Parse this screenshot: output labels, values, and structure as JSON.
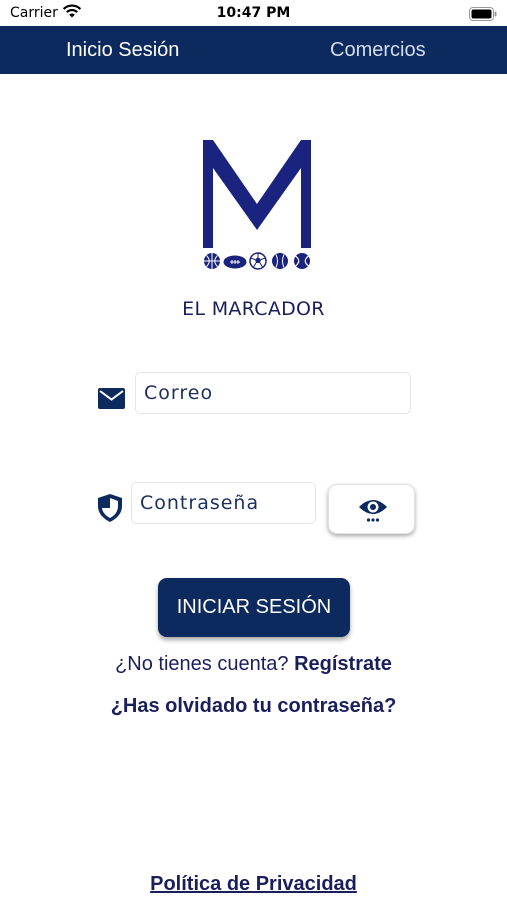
{
  "status_bar": {
    "carrier": "Carrier",
    "time": "10:47 PM",
    "icons": [
      "wifi-icon",
      "battery-icon"
    ]
  },
  "navbar": {
    "tabs": [
      {
        "label": "Inicio Sesión",
        "active": true
      },
      {
        "label": "Comercios",
        "active": false
      }
    ]
  },
  "logo": {
    "letter": "M",
    "app_name": "EL MARCADOR",
    "balls": [
      "basketball-icon",
      "football-icon",
      "soccer-ball-icon",
      "baseball-icon",
      "tennis-ball-icon"
    ]
  },
  "form": {
    "email_placeholder": "Correo",
    "email_value": "",
    "password_placeholder": "Contraseña",
    "password_value": "",
    "email_icon": "envelope-icon",
    "password_icon": "shield-icon",
    "toggle_icon": "eye-icon",
    "submit_label": "INICIAR SESIÓN"
  },
  "links": {
    "no_account": "¿No tienes cuenta?",
    "register": "Regístrate",
    "forgot_password": "¿Has olvidado tu contraseña?",
    "privacy": "Política de Privacidad"
  },
  "colors": {
    "primary": "#0c2a5e",
    "text": "#1a1f5c",
    "background": "#ffffff"
  }
}
